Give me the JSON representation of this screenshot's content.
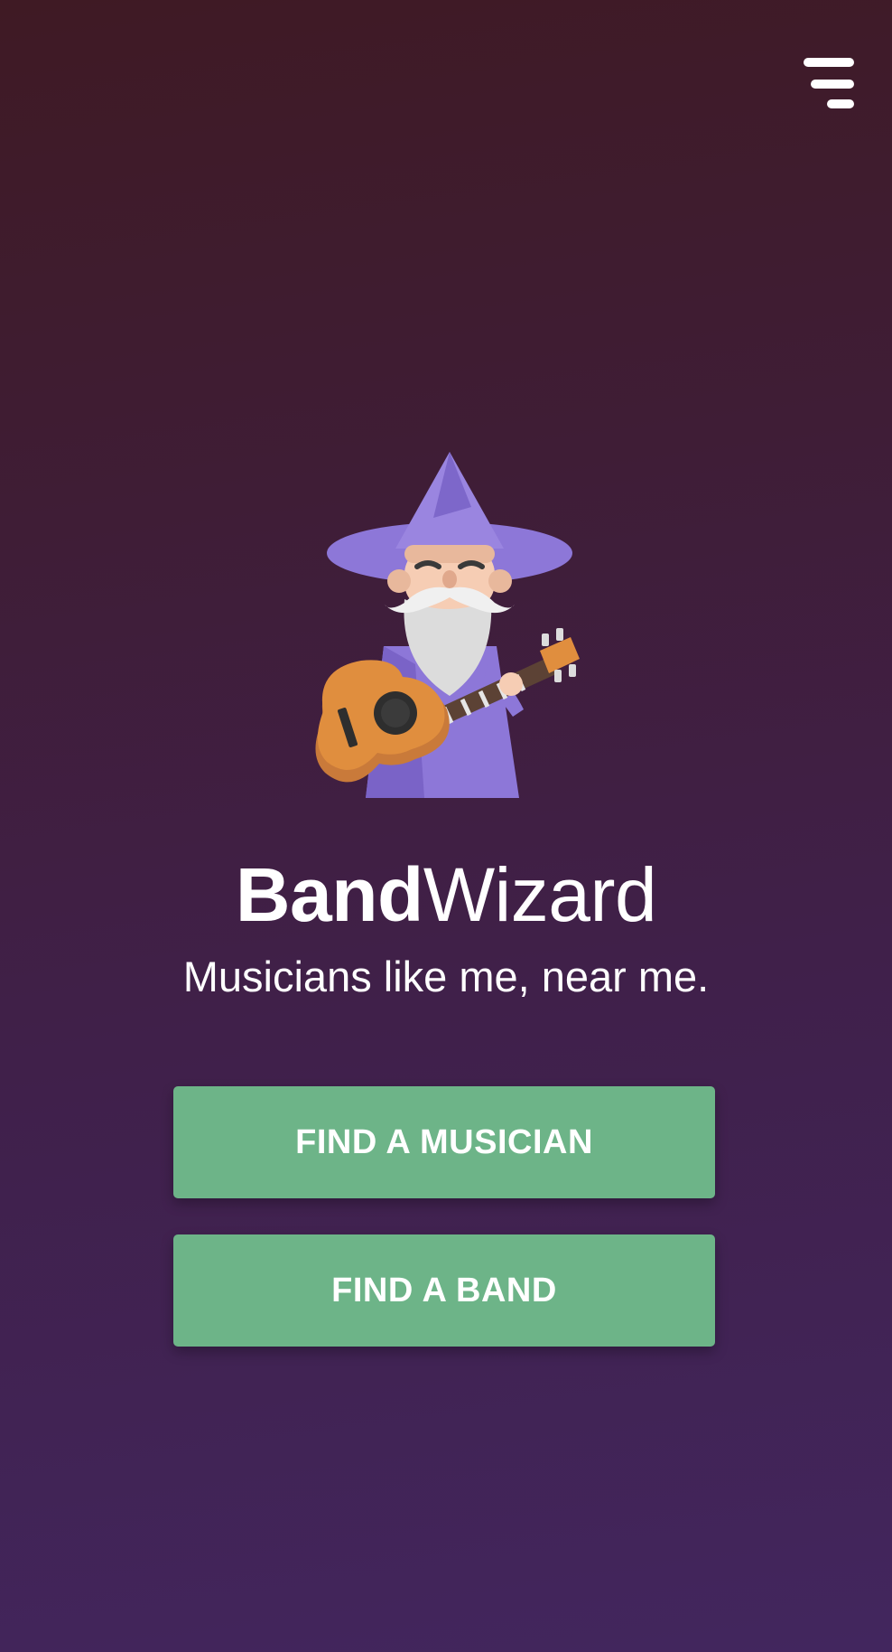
{
  "header": {
    "menu_icon": "hamburger-menu-icon"
  },
  "hero": {
    "mascot_icon": "wizard-with-guitar-illustration",
    "brand_bold": "Band",
    "brand_light": "Wizard",
    "tagline": "Musicians like me, near me."
  },
  "actions": {
    "find_musician_label": "FIND A MUSICIAN",
    "find_band_label": "FIND A BAND"
  },
  "colors": {
    "background_top": "#3f1a24",
    "background_bottom": "#42265e",
    "button": "#6db488",
    "text": "#ffffff"
  }
}
